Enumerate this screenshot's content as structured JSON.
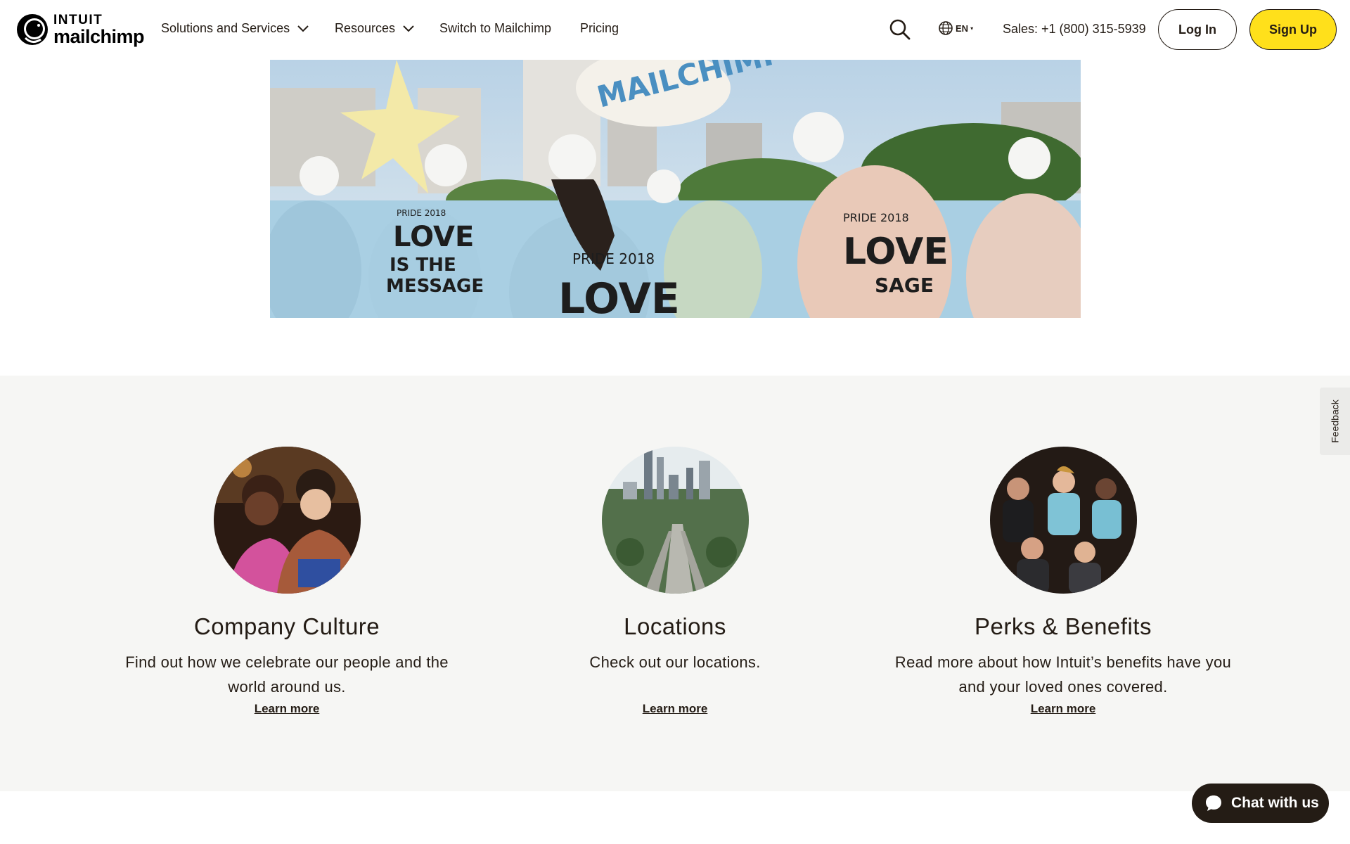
{
  "header": {
    "logo_line1": "INTUIT",
    "logo_line2": "mailchimp",
    "nav": [
      {
        "label": "Solutions and Services",
        "has_dropdown": true
      },
      {
        "label": "Resources",
        "has_dropdown": true
      },
      {
        "label": "Switch to Mailchimp",
        "has_dropdown": false
      },
      {
        "label": "Pricing",
        "has_dropdown": false
      }
    ],
    "search_icon": "search-icon",
    "language": "EN",
    "sales": "Sales: +1 (800) 315-5939",
    "login_label": "Log In",
    "signup_label": "Sign Up"
  },
  "hero": {
    "image": "pride-parade-photo",
    "shirt_text": [
      "PRIDE 2018",
      "LOVE",
      "IS THE",
      "MESSAGE"
    ],
    "balloon_text": "MAILCHIMP"
  },
  "cards": [
    {
      "image": "company-culture-photo",
      "title": "Company Culture",
      "description": "Find out how we celebrate our people and the world around us.",
      "link": "Learn more"
    },
    {
      "image": "locations-city-photo",
      "title": "Locations",
      "description": "Check out our locations.",
      "link": "Learn more"
    },
    {
      "image": "perks-benefits-photo",
      "title": "Perks & Benefits",
      "description": "Read more about how Intuit’s benefits have you and your loved ones covered.",
      "link": "Learn more"
    }
  ],
  "feedback_label": "Feedback",
  "chat_label": "Chat with us",
  "colors": {
    "accent_yellow": "#ffe01b",
    "text_dark": "#241c15",
    "section_gray": "#f6f6f4",
    "shirt_blue": "#a9cfe3"
  }
}
